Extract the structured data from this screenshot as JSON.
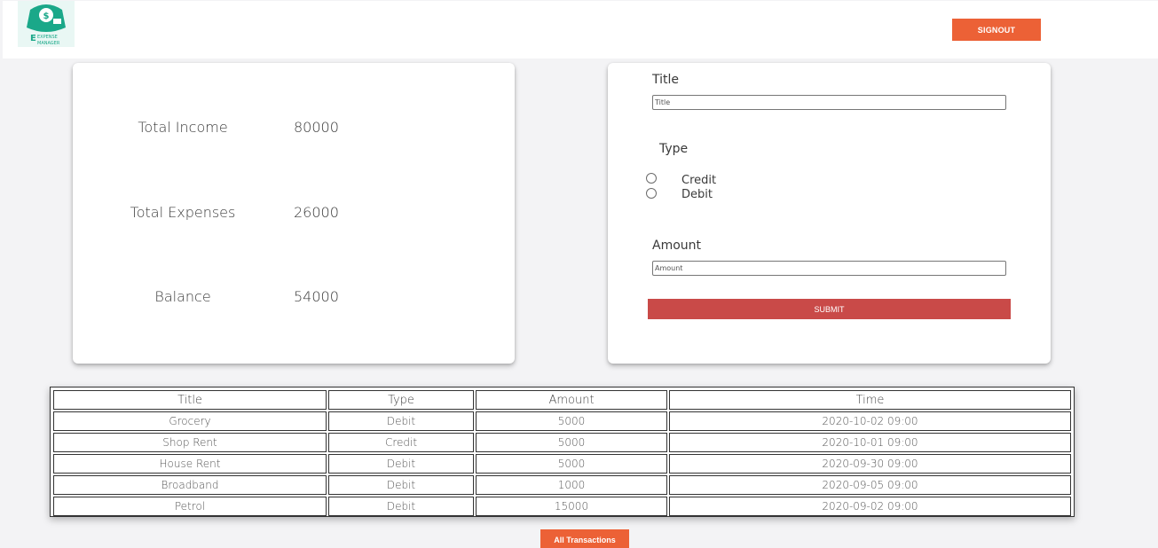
{
  "header": {
    "logo_alt": "Expense Manager",
    "logo_text_top": "EXPENSE",
    "logo_text_bottom": "MANAGER",
    "signout_label": "SIGNOUT"
  },
  "summary": {
    "rows": [
      {
        "label": "Total Income",
        "value": "80000"
      },
      {
        "label": "Total Expenses",
        "value": "26000"
      },
      {
        "label": "Balance",
        "value": "54000"
      }
    ]
  },
  "form": {
    "title_label": "Title",
    "title_placeholder": "Title",
    "type_label": "Type",
    "credit_label": "Credit",
    "debit_label": "Debit",
    "amount_label": "Amount",
    "amount_placeholder": "Amount",
    "submit_label": "SUBMIT"
  },
  "table": {
    "headers": [
      "Title",
      "Type",
      "Amount",
      "Time"
    ],
    "rows": [
      [
        "Grocery",
        "Debit",
        "5000",
        "2020-10-02 09:00"
      ],
      [
        "Shop Rent",
        "Credit",
        "5000",
        "2020-10-01 09:00"
      ],
      [
        "House Rent",
        "Debit",
        "5000",
        "2020-09-30 09:00"
      ],
      [
        "Broadband",
        "Debit",
        "1000",
        "2020-09-05 09:00"
      ],
      [
        "Petrol",
        "Debit",
        "15000",
        "2020-09-02 09:00"
      ]
    ]
  },
  "all_transactions_label": "All Transactions",
  "colors": {
    "accent": "#ec6136",
    "submit": "#c94a48",
    "logo": "#1aa889"
  }
}
